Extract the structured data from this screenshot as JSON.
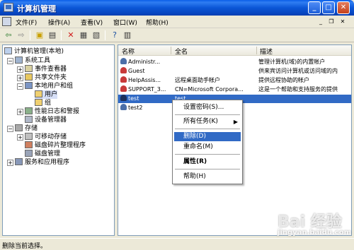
{
  "window": {
    "title": "计算机管理"
  },
  "menubar": {
    "items": [
      "文件(F)",
      "操作(A)",
      "查看(V)",
      "窗口(W)",
      "帮助(H)"
    ]
  },
  "toolbar": {
    "icons": [
      "back-arrow-icon",
      "forward-arrow-icon",
      "up-folder-icon",
      "show-tree-icon",
      "delete-icon",
      "properties-icon",
      "export-icon",
      "help-icon",
      "console-icon"
    ]
  },
  "tree": {
    "items": [
      {
        "label": "计算机管理(本地)"
      },
      {
        "label": "系统工具"
      },
      {
        "label": "事件查看器"
      },
      {
        "label": "共享文件夹"
      },
      {
        "label": "本地用户和组"
      },
      {
        "label": "用户"
      },
      {
        "label": "组"
      },
      {
        "label": "性能日志和警报"
      },
      {
        "label": "设备管理器"
      },
      {
        "label": "存储"
      },
      {
        "label": "可移动存储"
      },
      {
        "label": "磁盘碎片整理程序"
      },
      {
        "label": "磁盘管理"
      },
      {
        "label": "服务和应用程序"
      }
    ]
  },
  "list": {
    "headers": [
      "名称",
      "全名",
      "描述"
    ],
    "rows": [
      {
        "name": "Administr...",
        "fullname": "",
        "desc": "管理计算机(域)的内置帐户"
      },
      {
        "name": "Guest",
        "fullname": "",
        "desc": "供来宾访问计算机或访问域的内"
      },
      {
        "name": "HelpAssis...",
        "fullname": "远程桌面助手帐户",
        "desc": "提供远程协助的帐户"
      },
      {
        "name": "SUPPORT_3...",
        "fullname": "CN=Microsoft Corpora...",
        "desc": "这是一个帮助和支持服务的提供"
      },
      {
        "name": "test",
        "fullname": "test",
        "desc": ""
      },
      {
        "name": "test2",
        "fullname": "",
        "desc": ""
      }
    ]
  },
  "context_menu": {
    "items": [
      "设置密码(S)...",
      "所有任务(K)",
      "删除(D)",
      "重命名(M)",
      "属性(R)",
      "帮助(H)"
    ]
  },
  "status": {
    "text": "删除当前选择。"
  },
  "watermark": {
    "text": "Bai 经验",
    "sub": "jingyan.baidu.com"
  }
}
